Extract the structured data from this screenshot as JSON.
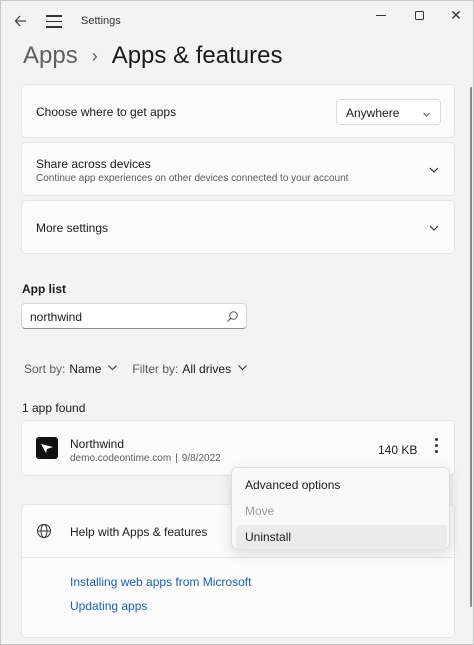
{
  "window": {
    "title": "Settings"
  },
  "breadcrumb": {
    "parent": "Apps",
    "separator": "›",
    "current": "Apps & features"
  },
  "settings": {
    "get_apps": {
      "label": "Choose where to get apps",
      "value": "Anywhere"
    },
    "share": {
      "label": "Share across devices",
      "description": "Continue app experiences on other devices connected to your account"
    },
    "more": {
      "label": "More settings"
    }
  },
  "app_list": {
    "heading": "App list",
    "search_value": "northwind",
    "sort_label": "Sort by:",
    "sort_value": "Name",
    "filter_label": "Filter by:",
    "filter_value": "All drives",
    "found_text": "1 app found"
  },
  "app": {
    "name": "Northwind",
    "publisher": "demo.codeontime.com",
    "separator": "|",
    "date": "9/8/2022",
    "size": "140 KB"
  },
  "context_menu": {
    "items": [
      {
        "label": "Advanced options",
        "state": "normal"
      },
      {
        "label": "Move",
        "state": "disabled"
      },
      {
        "label": "Uninstall",
        "state": "hover"
      }
    ]
  },
  "help": {
    "title": "Help with Apps & features",
    "links": [
      "Installing web apps from Microsoft",
      "Updating apps"
    ]
  },
  "icons": {
    "back": "back-arrow-icon",
    "menu": "hamburger-icon",
    "search": "search-icon",
    "help": "globe-icon",
    "app": "northwind-app-icon"
  },
  "colors": {
    "link": "#1a5fb4",
    "background": "#f3f3f3",
    "card": "#fbfbfb"
  }
}
